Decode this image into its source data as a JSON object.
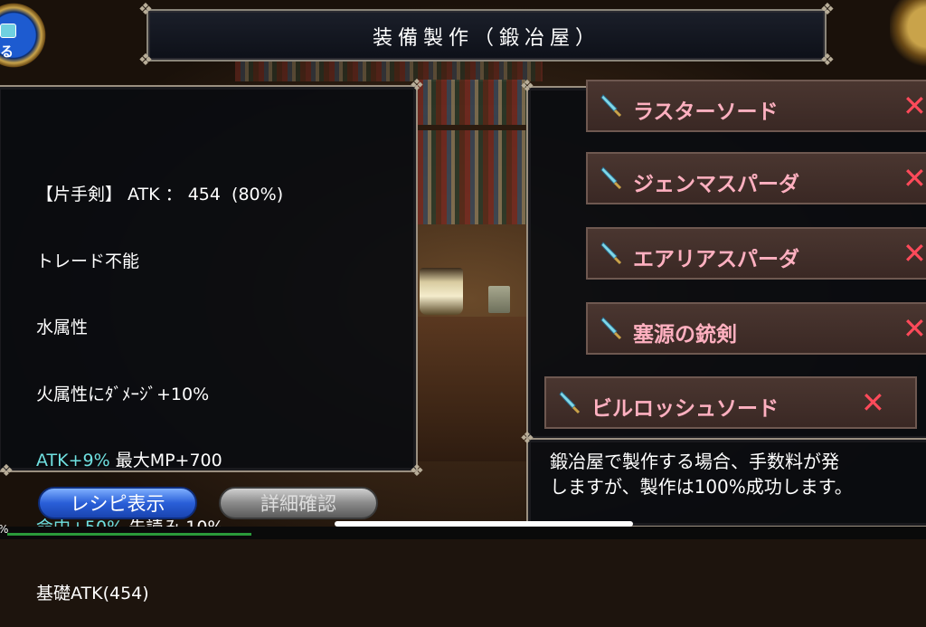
{
  "title": "装備製作（鍛冶屋）",
  "top_badge_label": "る",
  "stats": [
    {
      "text": "【片手剣】 ATK ： 454  (80%)"
    },
    {
      "text": "トレード不能"
    },
    {
      "text": "水属性"
    },
    {
      "text": "火属性にﾀﾞﾒｰｼﾞ+10%"
    },
    {
      "hl": "ATK+9%",
      "rest": " 最大MP+700"
    },
    {
      "hl": "命中+50%",
      "rest": " 先読み 10%"
    },
    {
      "text": "基礎ATK(454)"
    }
  ],
  "recipes": [
    {
      "name": "ラスターソード",
      "remove": "✕"
    },
    {
      "name": "ジェンマスパーダ",
      "remove": "✕"
    },
    {
      "name": "エアリアスパーダ",
      "remove": "✕"
    },
    {
      "name": "塞源の銃剣",
      "remove": "✕"
    },
    {
      "name": "ビルロッシュソード",
      "remove": "✕"
    }
  ],
  "message": {
    "line1": "鍛冶屋で製作する場合、手数料が発",
    "line2": "しますが、製作は100%成功します。"
  },
  "buttons": {
    "recipe": "レシピ表示",
    "detail": "詳細確認"
  },
  "bottom_pct": "%",
  "colors": {
    "item_name": "#ffb0c0",
    "remove": "#ff4a5a",
    "highlight": "#6fe0e0"
  }
}
